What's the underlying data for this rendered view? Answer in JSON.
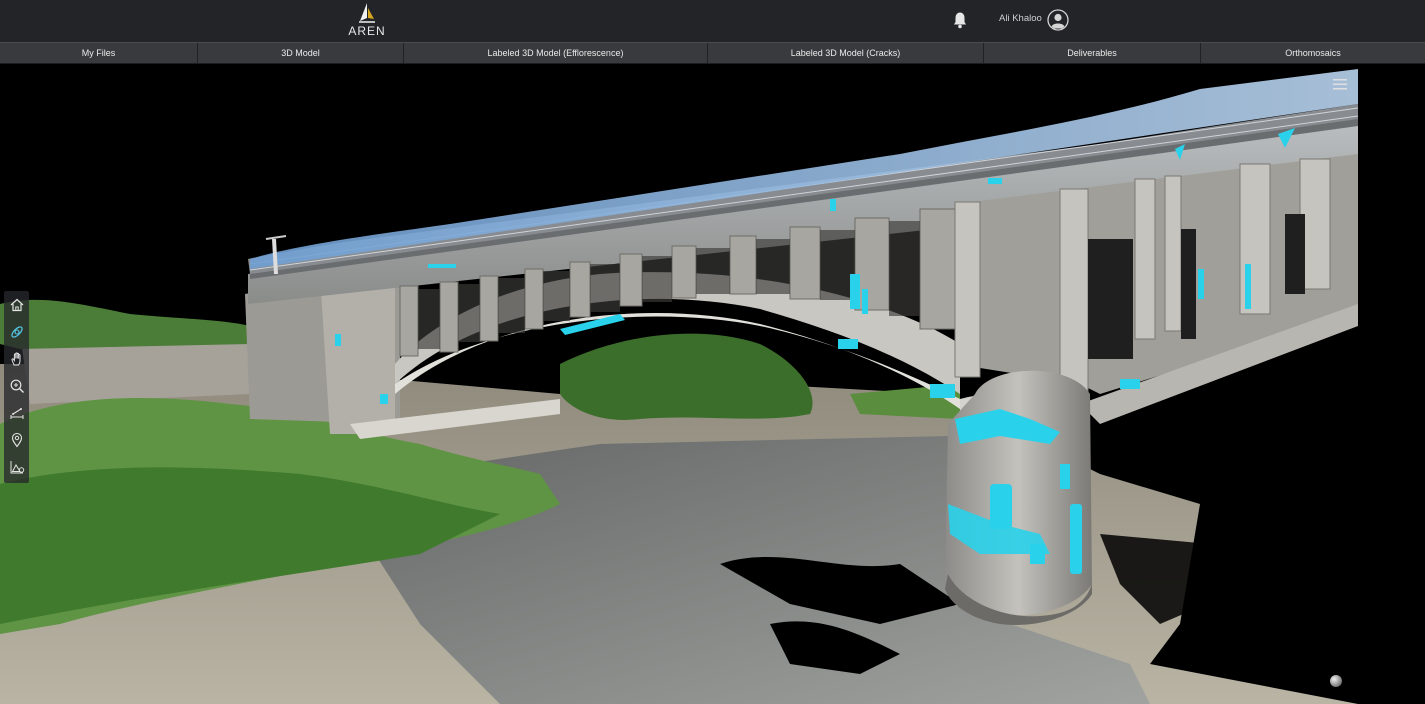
{
  "header": {
    "logo_text": "AREN",
    "notifications_icon": "bell-icon",
    "user_name": "Ali Khaloo",
    "avatar_icon": "user-circle-icon"
  },
  "tabs": [
    {
      "label": "My Files"
    },
    {
      "label": "3D Model"
    },
    {
      "label": "Labeled 3D Model (Efflorescence)"
    },
    {
      "label": "Labeled 3D Model (Cracks)"
    },
    {
      "label": "Deliverables"
    },
    {
      "label": "Orthomosaics"
    }
  ],
  "viewer": {
    "menu_icon": "hamburger-menu-icon",
    "tools": [
      {
        "icon": "home-icon"
      },
      {
        "icon": "orbit-icon",
        "active": true
      },
      {
        "icon": "pan-hand-icon"
      },
      {
        "icon": "zoom-icon"
      },
      {
        "icon": "measure-icon"
      },
      {
        "icon": "location-pin-icon"
      },
      {
        "icon": "area-measure-icon"
      }
    ],
    "navigation_icon": "navigation-sphere-icon"
  },
  "colors": {
    "header_bg": "#232427",
    "tab_bg": "#393a3d",
    "label_highlight": "#29d2ea",
    "active_tool": "#55c8e8"
  }
}
